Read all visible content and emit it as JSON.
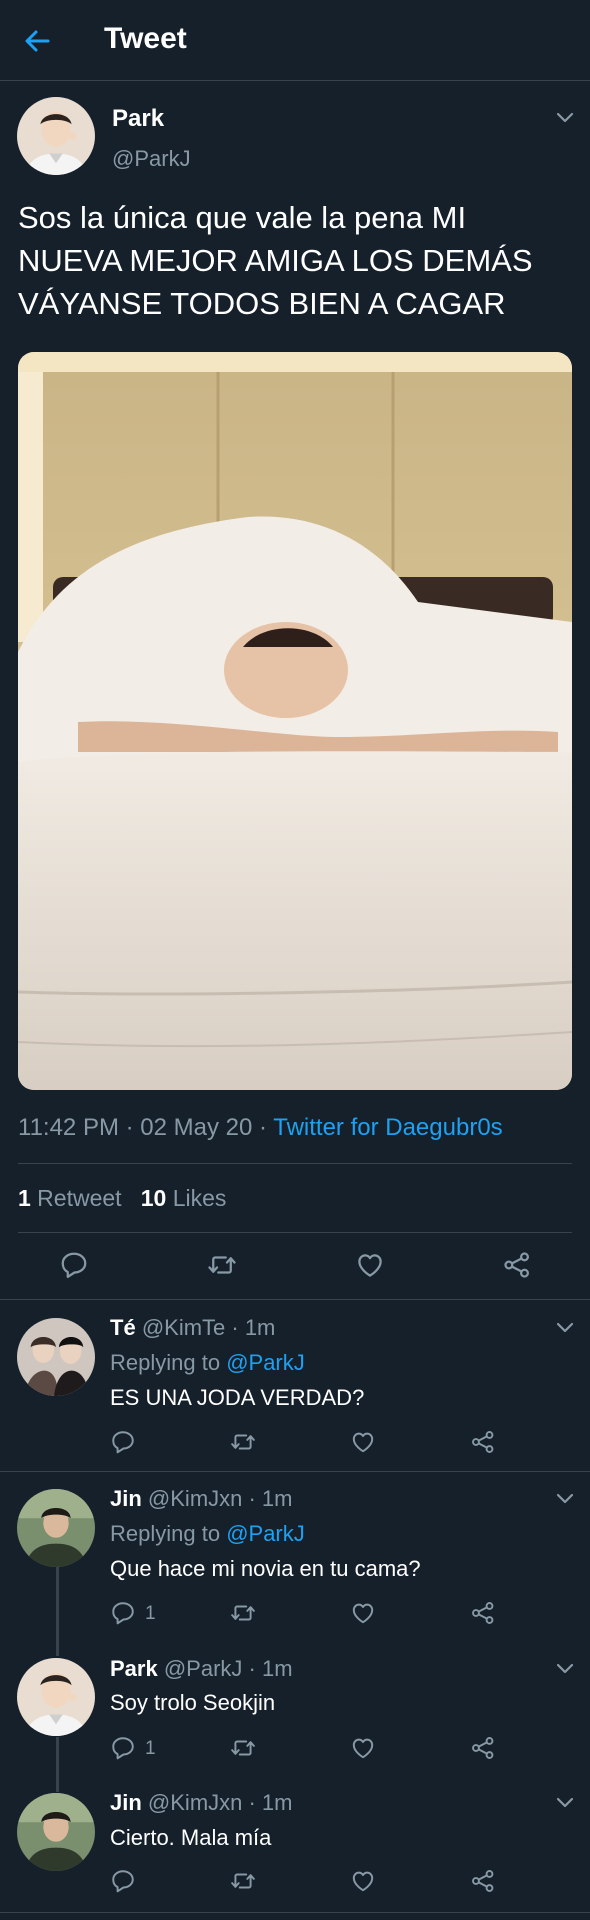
{
  "header": {
    "title": "Tweet"
  },
  "tweet": {
    "name": "Park",
    "handle": "@ParkJ",
    "text_lines": [
      "Sos la única que vale la pena MI",
      "NUEVA MEJOR AMIGA LOS DEMÁS",
      "VÁYANSE TODOS BIEN A CAGAR"
    ],
    "time": "11:42 PM · 02 May 20 · ",
    "source": "Twitter for Daegubr0s",
    "retweets_count": "1",
    "retweets_label": " Retweet",
    "likes_count": "10",
    "likes_label": " Likes"
  },
  "replies": [
    {
      "name": "Té",
      "handle": "@KimTe · 1m",
      "replying_prefix": "Replying to ",
      "replying_to": "@ParkJ",
      "text": "ES UNA JODA VERDAD?",
      "reply_count": ""
    },
    {
      "name": "Jin",
      "handle": "@KimJxn · 1m",
      "replying_prefix": "Replying to ",
      "replying_to": "@ParkJ",
      "text": "Que hace mi novia en tu cama?",
      "reply_count": "1"
    },
    {
      "name": "Park",
      "handle": "@ParkJ · 1m",
      "text": "Soy trolo Seokjin",
      "reply_count": "1"
    },
    {
      "name": "Jin",
      "handle": "@KimJxn · 1m",
      "text": "Cierto. Mala mía",
      "reply_count": ""
    }
  ],
  "colors": {
    "background": "#15202b",
    "accent": "#1da1f2",
    "secondary_text": "#8899a6",
    "divider": "#38444d"
  },
  "icons": [
    "back-arrow-icon",
    "chevron-down-icon",
    "reply-icon",
    "retweet-icon",
    "like-icon",
    "share-icon"
  ]
}
